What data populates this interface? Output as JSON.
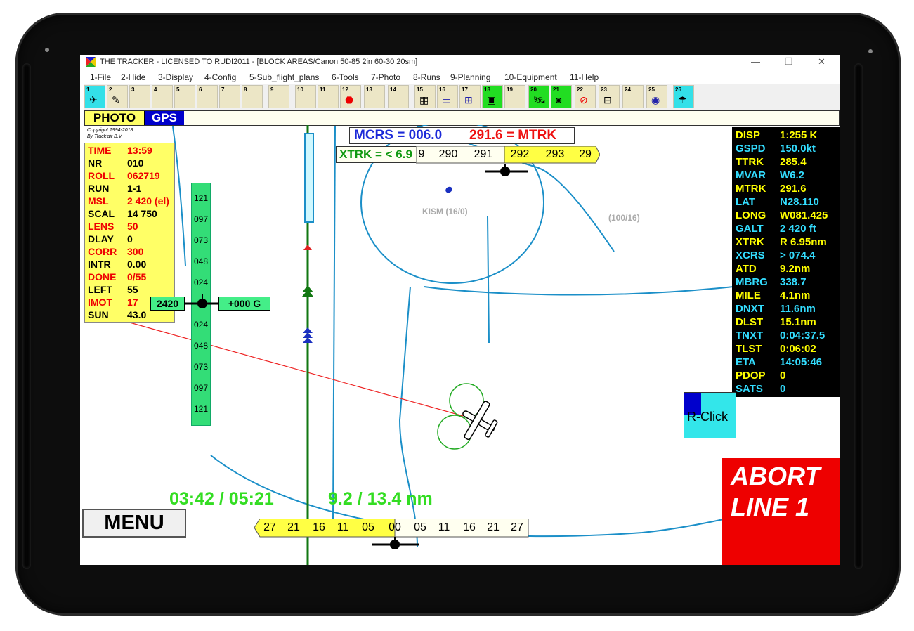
{
  "window": {
    "title": "THE TRACKER - LICENSED TO RUDI2011 - [BLOCK AREAS/Canon 50-85 2in 60-30 20sm]",
    "min": "—",
    "max": "❐",
    "close": "✕"
  },
  "menu": [
    "1-File",
    "2-Hide",
    "3-Display",
    "4-Config",
    "5-Sub_flight_plans",
    "6-Tools",
    "7-Photo",
    "8-Runs",
    "9-Planning",
    "10-Equipment",
    "11-Help"
  ],
  "toolbar": [
    "1",
    "2",
    "3",
    "4",
    "5",
    "6",
    "7",
    "8",
    "9",
    "10",
    "11",
    "12",
    "13",
    "14",
    "15",
    "16",
    "17",
    "18",
    "19",
    "20",
    "21",
    "22",
    "23",
    "24",
    "25",
    "26"
  ],
  "mode": {
    "photo": "PHOTO",
    "gps": "GPS"
  },
  "copyright": {
    "line1": "Copyright 1994-2018",
    "line2": "By Track'air B.V."
  },
  "left_panel": [
    {
      "k": "TIME",
      "v": "13:59",
      "color": "red"
    },
    {
      "k": "NR",
      "v": "010",
      "color": "black"
    },
    {
      "k": "ROLL",
      "v": "062719",
      "color": "red"
    },
    {
      "k": "RUN",
      "v": "1-1",
      "color": "black"
    },
    {
      "k": "MSL",
      "v": "2 420 (el)",
      "color": "red"
    },
    {
      "k": "SCAL",
      "v": "14 750",
      "color": "black"
    },
    {
      "k": "LENS",
      "v": "50",
      "color": "red"
    },
    {
      "k": "DLAY",
      "v": "0",
      "color": "black"
    },
    {
      "k": "CORR",
      "v": "300",
      "color": "red"
    },
    {
      "k": "INTR",
      "v": "0.00",
      "color": "black"
    },
    {
      "k": "DONE",
      "v": "0/55",
      "color": "red"
    },
    {
      "k": "LEFT",
      "v": "55",
      "color": "black"
    },
    {
      "k": "IMOT",
      "v": "17",
      "color": "red"
    },
    {
      "k": "SUN",
      "v": "43.0",
      "color": "black"
    }
  ],
  "right_panel": [
    {
      "k": "DISP",
      "v": "1:255 K",
      "color": "yellow"
    },
    {
      "k": "GSPD",
      "v": "150.0kt",
      "color": "cyan"
    },
    {
      "k": "TTRK",
      "v": "285.4",
      "color": "yellow"
    },
    {
      "k": "MVAR",
      "v": "W6.2",
      "color": "cyan"
    },
    {
      "k": "MTRK",
      "v": "291.6",
      "color": "yellow"
    },
    {
      "k": "LAT",
      "v": "N28.110",
      "color": "cyan"
    },
    {
      "k": "LONG",
      "v": "W081.425",
      "color": "yellow"
    },
    {
      "k": "GALT",
      "v": "2 420 ft",
      "color": "cyan"
    },
    {
      "k": "XTRK",
      "v": "R 6.95nm",
      "color": "yellow"
    },
    {
      "k": "XCRS",
      "v": "> 074.4",
      "color": "cyan"
    },
    {
      "k": "ATD",
      "v": "9.2nm",
      "color": "yellow"
    },
    {
      "k": "MBRG",
      "v": "338.7",
      "color": "cyan"
    },
    {
      "k": "MILE",
      "v": "4.1nm",
      "color": "yellow"
    },
    {
      "k": "DNXT",
      "v": "11.6nm",
      "color": "cyan"
    },
    {
      "k": "DLST",
      "v": "15.1nm",
      "color": "yellow"
    },
    {
      "k": "TNXT",
      "v": "0:04:37.5",
      "color": "cyan"
    },
    {
      "k": "TLST",
      "v": "0:06:02",
      "color": "yellow"
    },
    {
      "k": "ETA",
      "v": "14:05:46",
      "color": "cyan"
    },
    {
      "k": "PDOP",
      "v": "0",
      "color": "yellow"
    },
    {
      "k": "SATS",
      "v": "0",
      "color": "cyan"
    }
  ],
  "course": {
    "mcrs": "MCRS = 006.0",
    "mtrk": "291.6 = MTRK",
    "xtrk": "XTRK = < 6.9"
  },
  "heading_tape": [
    "9",
    "290",
    "291",
    "292",
    "293",
    "29"
  ],
  "altitude": {
    "value": "2420",
    "vs": "+000 G"
  },
  "alt_tape": [
    "121",
    "097",
    "073",
    "048",
    "024",
    "024",
    "048",
    "073",
    "097",
    "121"
  ],
  "bottom_tape": [
    "27",
    "21",
    "16",
    "11",
    "05",
    "00",
    "05",
    "11",
    "16",
    "21",
    "27"
  ],
  "progress": {
    "time": "03:42 / 05:21",
    "distance": "9.2 / 13.4 nm"
  },
  "map": {
    "kism": "KISM (16/0)",
    "area": "(100/16)"
  },
  "buttons": {
    "menu": "MENU",
    "rclick": "R-Click",
    "abort_l1": "ABORT",
    "abort_l2": "LINE 1"
  }
}
